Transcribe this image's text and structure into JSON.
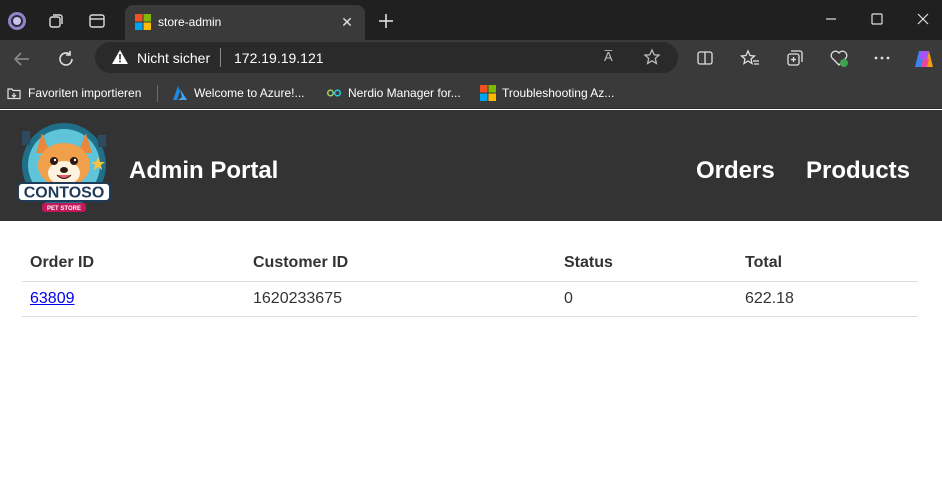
{
  "browser": {
    "tab_title": "store-admin",
    "tab_close": "✕",
    "security_label": "Nicht sicher",
    "url": "172.19.19.121",
    "read_aloud": "A̅",
    "bookmarks": [
      {
        "label": "Favoriten importieren",
        "icon": "import-favorites-icon"
      },
      {
        "label": "Welcome to Azure!...",
        "icon": "azure-icon"
      },
      {
        "label": "Nerdio Manager for...",
        "icon": "nerdio-icon"
      },
      {
        "label": "Troubleshooting Az...",
        "icon": "microsoft-icon"
      }
    ]
  },
  "header": {
    "title": "Admin Portal",
    "nav": [
      "Orders",
      "Products"
    ],
    "logo_text": "CONTOSO",
    "logo_subtext": "PET STORE"
  },
  "orders_table": {
    "columns": [
      "Order ID",
      "Customer ID",
      "Status",
      "Total"
    ],
    "rows": [
      {
        "order_id": "63809",
        "customer_id": "1620233675",
        "status": "0",
        "total": "622.18"
      }
    ]
  },
  "colors": {
    "chrome_dark": "#202020",
    "chrome_toolbar": "#3a3a3a",
    "header_bg": "#333333",
    "link": "#0000ee"
  }
}
